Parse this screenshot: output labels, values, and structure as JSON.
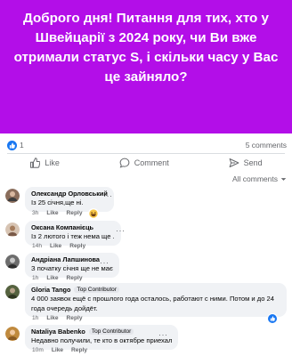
{
  "post": {
    "text": "Доброго дня! Питання для тих, хто у Швейцарії з 2024 року, чи Ви вже отримали статус S, і скільки часу у Вас це зайняло?",
    "background_color": "#b30ee8",
    "reactions_count": "1",
    "comments_count": "5 comments"
  },
  "actions": {
    "like": "Like",
    "comment": "Comment",
    "send": "Send"
  },
  "sort": {
    "label": "All comments"
  },
  "comments": [
    {
      "author": "Олександр Орловський",
      "badge": "",
      "text": "Із 25 січня,ще ні.",
      "time": "3h",
      "like": "Like",
      "reply": "Reply",
      "reaction": "haha"
    },
    {
      "author": "Оксана Компанієць",
      "badge": "",
      "text": "Із 2 лютого і теж нема ще .",
      "time": "14h",
      "like": "Like",
      "reply": "Reply"
    },
    {
      "author": "Андріана Лапшинова",
      "badge": "",
      "text": "З початку січня ще не має",
      "time": "1h",
      "like": "Like",
      "reply": "Reply"
    },
    {
      "author": "Gloria Tango",
      "badge": "Top Contributor",
      "text": "4 000 заявок ещё с прошлого года осталось, работают с ними. Потом и до 24 года очередь дойдёт.",
      "time": "1h",
      "like": "Like",
      "reply": "Reply",
      "reaction": "like"
    },
    {
      "author": "Nataliya Babenko",
      "badge": "Top Contributor",
      "text": "Недавно получили, те кто в октябре приехал",
      "time": "10m",
      "like": "Like",
      "reply": "Reply"
    }
  ]
}
